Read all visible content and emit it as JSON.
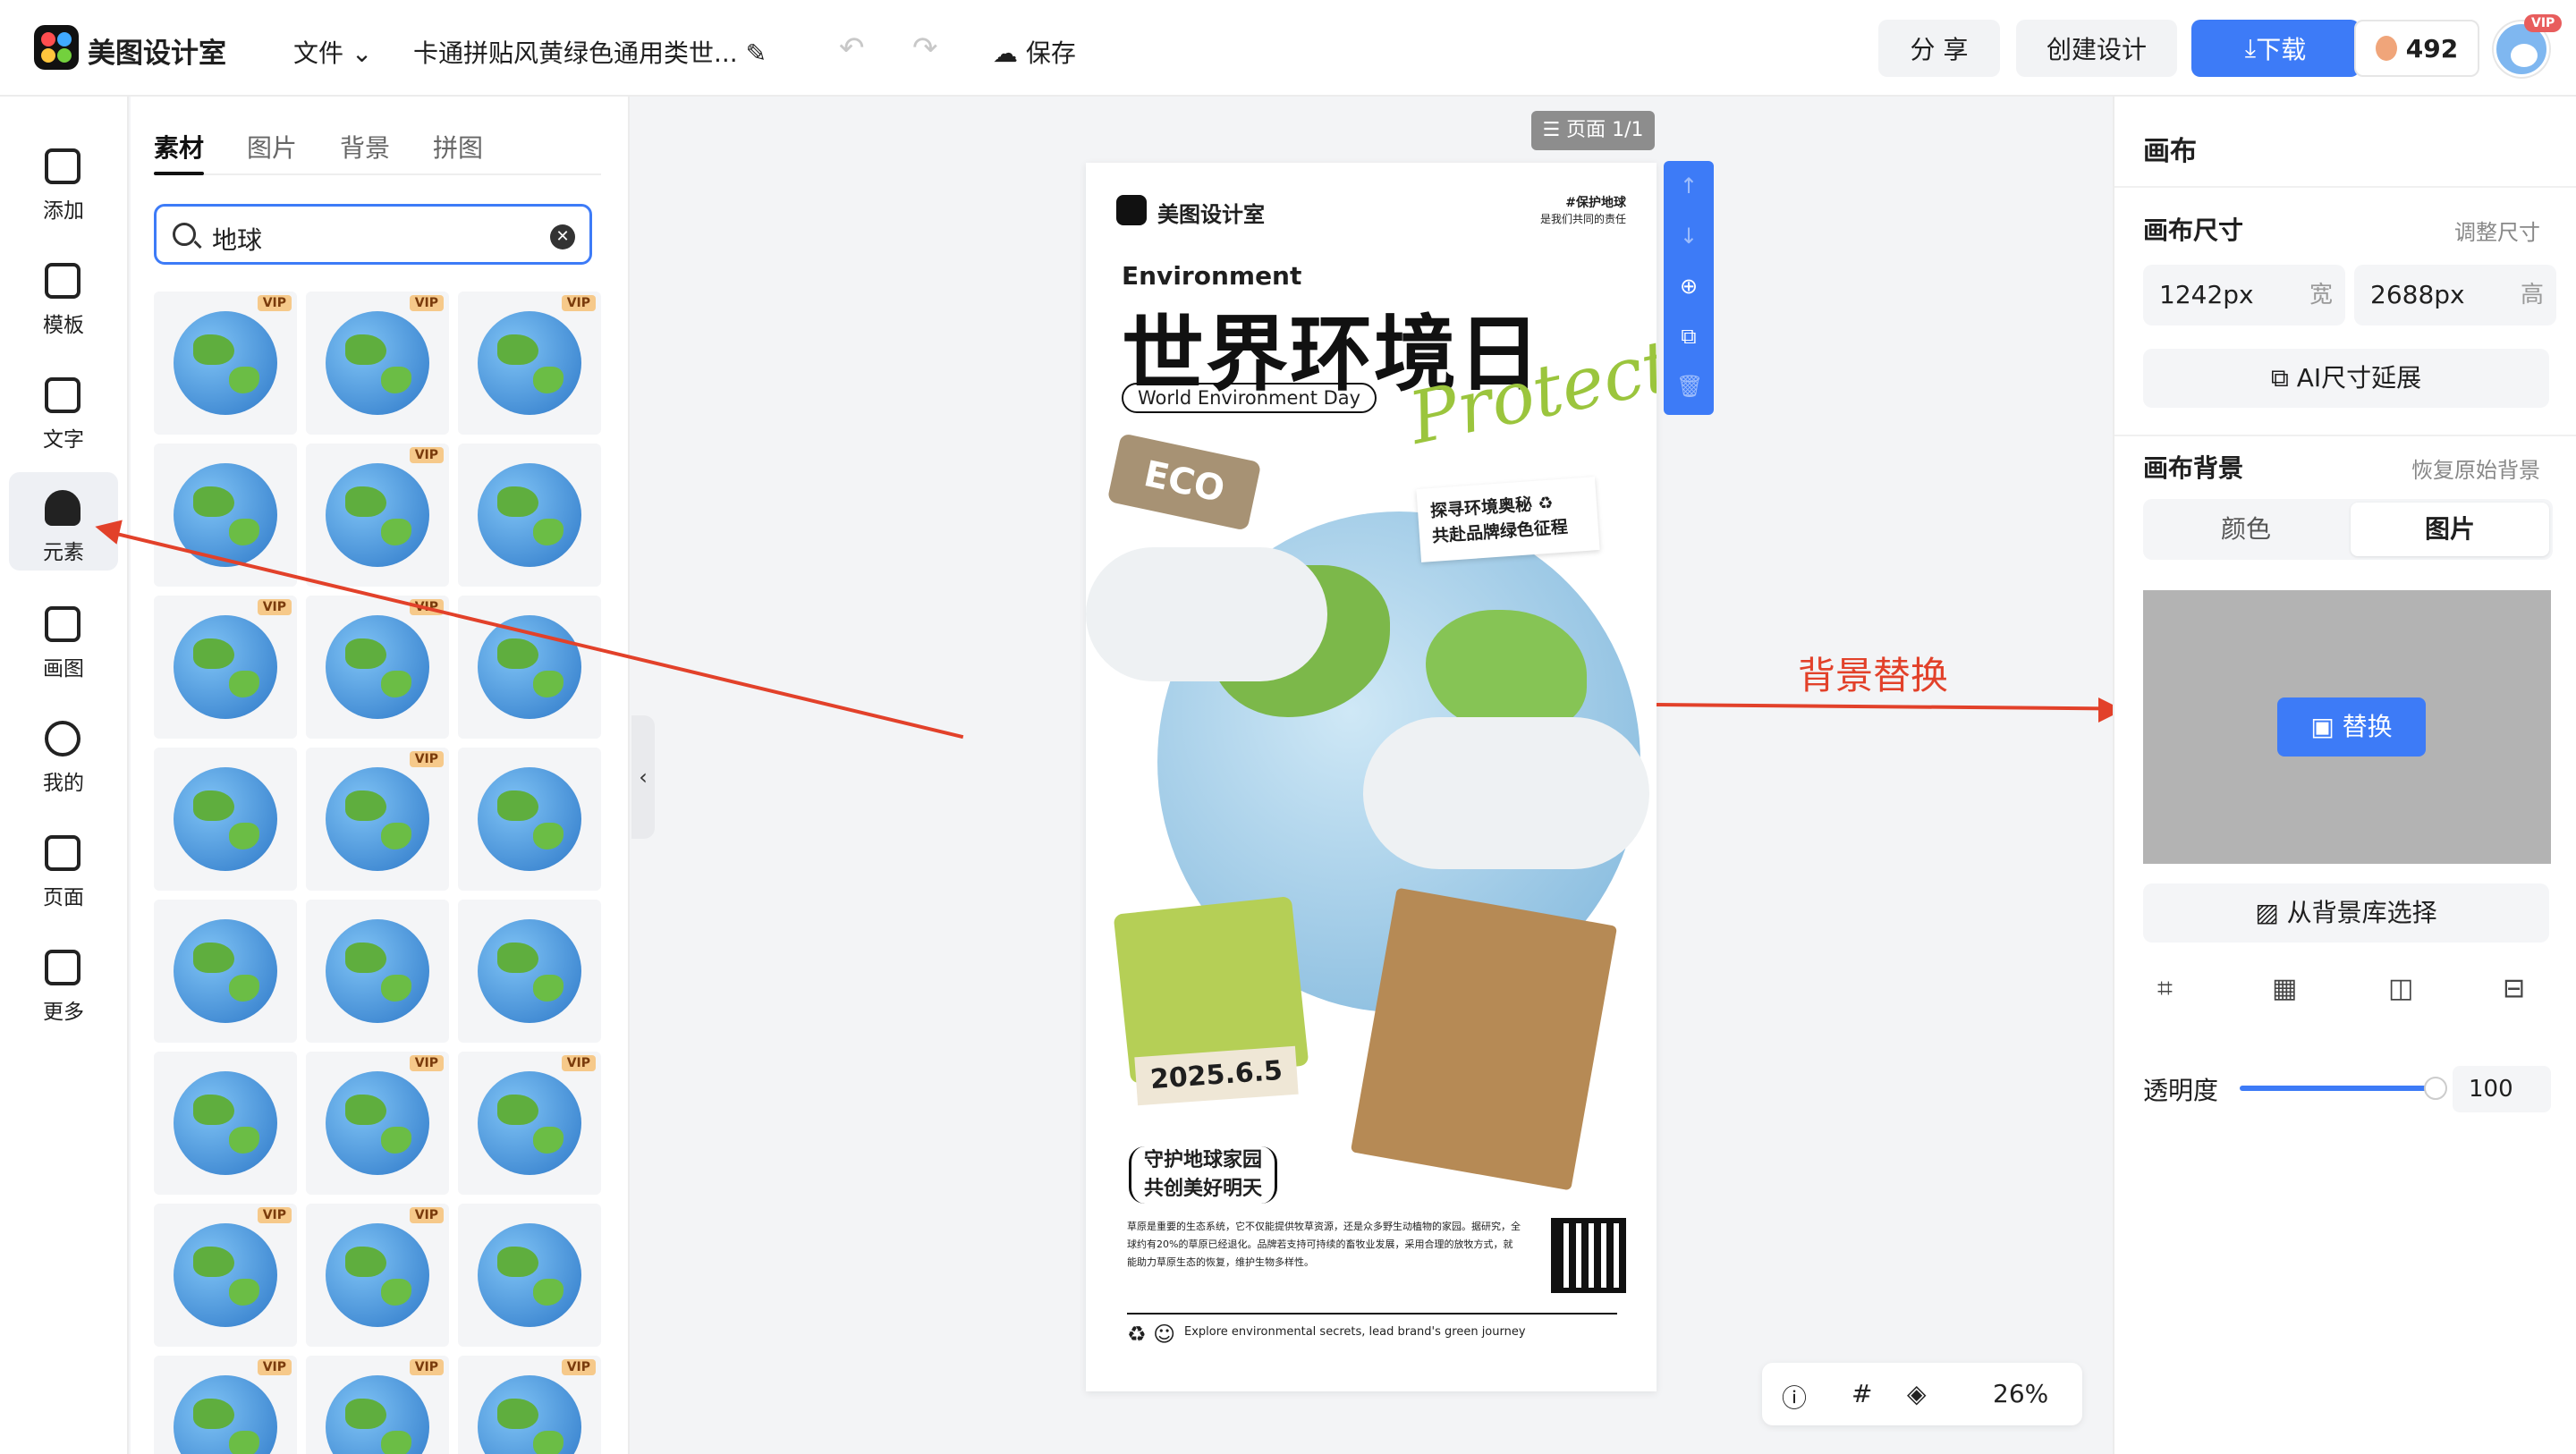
{
  "header": {
    "brand": "美图设计室",
    "file_menu": "文件 ⌄",
    "doc_title": "卡通拼贴风黄绿色通用类世... ✎",
    "save_label": "保存",
    "share_label": "分 享",
    "create_label": "创建设计",
    "download_label": "下载",
    "coins": "492",
    "vip_badge": "VIP"
  },
  "toolbar": {
    "items": [
      {
        "label": "添加"
      },
      {
        "label": "模板"
      },
      {
        "label": "文字"
      },
      {
        "label": "元素"
      },
      {
        "label": "画图"
      },
      {
        "label": "我的"
      },
      {
        "label": "页面"
      },
      {
        "label": "更多"
      }
    ]
  },
  "panel": {
    "tabs": [
      "素材",
      "图片",
      "背景",
      "拼图"
    ],
    "active_tab": "素材",
    "search_value": "地球",
    "vip_label": "VIP"
  },
  "canvas": {
    "page_indicator": "☰ 页面 1/1",
    "zoom": "26%"
  },
  "poster": {
    "brand": "美图设计室",
    "tag_line1": "#保护地球",
    "tag_line2": "是我们共同的责任",
    "environment": "Environment",
    "title": "世界环境日",
    "subtitle": "World Environment Day",
    "protect": "Protect",
    "eco": "ECO",
    "note_line1": "探寻环境奥秘 ♻",
    "note_line2": "共赴品牌绿色征程",
    "date": "2025.6.5",
    "slogan_line1": "守护地球家园",
    "slogan_line2": "共创美好明天",
    "body": "草原是重要的生态系统，它不仅能提供牧草资源，还是众多野生动植物的家园。据研究，全球约有20%的草原已经退化。品牌若支持可持续的畜牧业发展，采用合理的放牧方式，就能助力草原生态的恢复，维护生物多样性。",
    "footer": "Explore environmental secrets, lead brand's green journey"
  },
  "annotation": {
    "label": "背景替换",
    "color": "#e2412a"
  },
  "right_panel": {
    "title": "画布",
    "size_label": "画布尺寸",
    "resize_link": "调整尺寸",
    "width_value": "1242px",
    "width_unit": "宽",
    "height_value": "2688px",
    "height_unit": "高",
    "ai_extend": "AI尺寸延展",
    "bg_label": "画布背景",
    "restore_link": "恢复原始背景",
    "seg_color": "颜色",
    "seg_image": "图片",
    "replace_label": "替换",
    "library_label": "从背景库选择",
    "opacity_label": "透明度",
    "opacity_value": "100"
  },
  "colors": {
    "accent": "#3d7bf7",
    "annotation": "#e2412a"
  }
}
